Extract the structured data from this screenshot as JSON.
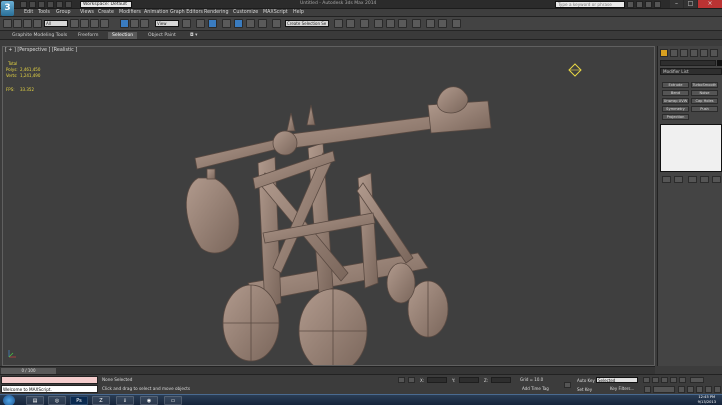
{
  "titlebar": {
    "app_logo": "3",
    "workspace": "Workspace: Default",
    "window_title": "Untitled - Autodesk 3ds Max 2014",
    "search_placeholder": "Type a keyword or phrase"
  },
  "menu": [
    "Edit",
    "Tools",
    "Group",
    "Views",
    "Create",
    "Modifiers",
    "Animation",
    "Graph Editors",
    "Rendering",
    "Customize",
    "MAXScript",
    "Help"
  ],
  "toolbar": {
    "selection_filter": "All",
    "ref_coord": "View",
    "named_selection": "Create Selection Se"
  },
  "ribbon": {
    "tabs": [
      "Graphite Modeling Tools",
      "Freeform",
      "Selection",
      "Object Paint"
    ],
    "active_tab": "Selection"
  },
  "viewport": {
    "label": "[ + ] [Perspective ] [Realistic ]",
    "stats": {
      "total_label": "Total",
      "polys_label": "Polys:",
      "polys_value": "2,461,450",
      "verts_label": "Verts:",
      "verts_value": "1,241,490",
      "fps_label": "FPS:",
      "fps_value": "33.352"
    }
  },
  "command_panel": {
    "modifier_list": "Modifier List",
    "modifier_buttons": [
      "Extrude",
      "TurboSmooth",
      "Bend",
      "Noise",
      "Unwrap UVW",
      "Cap Holes",
      "Symmetry",
      "Push",
      "Projection"
    ]
  },
  "timeline": {
    "frame_counter": "0 / 100"
  },
  "statusbar": {
    "maxscript_output": "Welcome to MAXScript.",
    "selection_status": "None Selected",
    "prompt": "Click and drag to select and move objects",
    "x_label": "X:",
    "y_label": "Y:",
    "z_label": "Z:",
    "grid": "Grid = 10.0",
    "add_time_tag": "Add Time Tag",
    "auto_key": "Auto Key",
    "set_key": "Set Key",
    "key_mode": "Selected",
    "key_filters": "Key Filters..."
  },
  "taskbar": {
    "apps": [
      "explorer",
      "3ds-max",
      "photoshop",
      "zbrush",
      "download",
      "chrome",
      "folder"
    ],
    "time": "12:45 PM",
    "date": "9/13/2013"
  },
  "colors": {
    "ui_bg": "#3c3c3c",
    "viewport_bg": "#3f3f3f",
    "stats": "#e9d844",
    "model": "#a0877a",
    "active_tool": "#3a7cc0"
  }
}
